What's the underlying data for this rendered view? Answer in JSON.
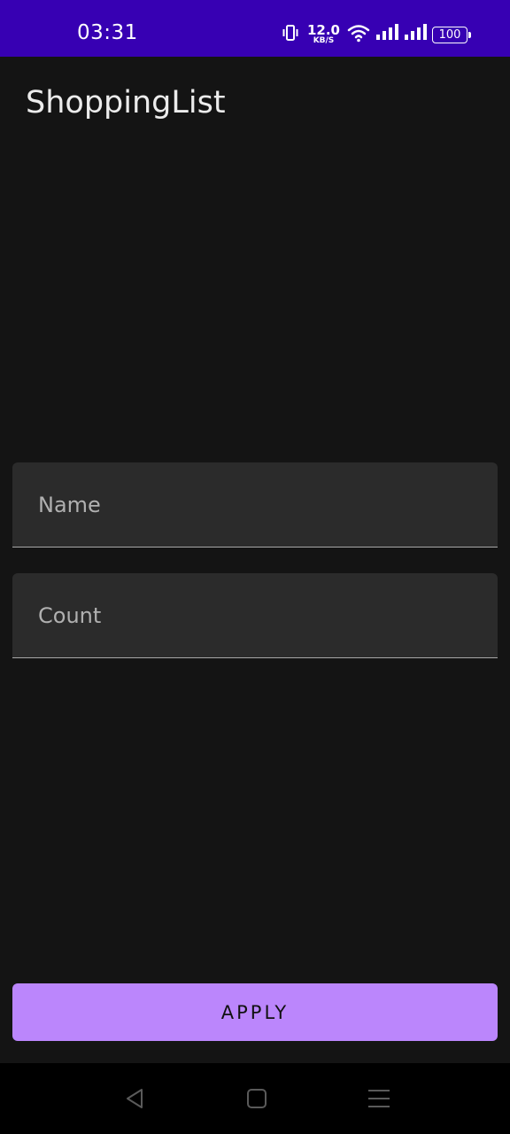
{
  "status_bar": {
    "time": "03:31",
    "net_speed_value": "12.0",
    "net_speed_unit": "KB/S",
    "battery": "100",
    "icons": [
      "vibrate-icon",
      "wifi-icon",
      "signal-icon",
      "signal-icon",
      "battery-icon"
    ],
    "background_color": "#3700b3"
  },
  "app_bar": {
    "title": "ShoppingList"
  },
  "form": {
    "name_placeholder": "Name",
    "name_value": "",
    "count_placeholder": "Count",
    "count_value": ""
  },
  "apply_button": {
    "label": "APPLY",
    "color": "#bb86fc"
  },
  "nav_bar": {
    "icons": [
      "back-icon",
      "home-icon",
      "menu-icon"
    ]
  }
}
